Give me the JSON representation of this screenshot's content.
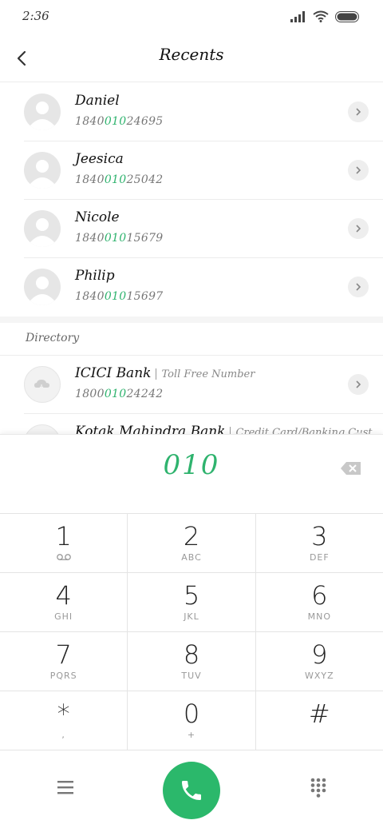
{
  "status": {
    "time": "2:36"
  },
  "header": {
    "title": "Recents"
  },
  "recents": [
    {
      "name": "Daniel",
      "number_pre": "1840",
      "number_match": "010",
      "number_post": "24695"
    },
    {
      "name": "Jeesica",
      "number_pre": "1840",
      "number_match": "010",
      "number_post": "25042"
    },
    {
      "name": "Nicole",
      "number_pre": "1840",
      "number_match": "010",
      "number_post": "15679"
    },
    {
      "name": "Philip",
      "number_pre": "1840",
      "number_match": "010",
      "number_post": "15697"
    }
  ],
  "directory": {
    "label": "Directory",
    "items": [
      {
        "name": "ICICI Bank",
        "subtitle": "Toll Free Number",
        "number_pre": "1800",
        "number_match": "010",
        "number_post": "24242"
      },
      {
        "name": "Kotak Mahindra Bank",
        "subtitle": "Credit Card/Banking Cust",
        "number_pre": "",
        "number_match": "",
        "number_post": ""
      }
    ]
  },
  "dialer": {
    "input": "010",
    "keys": [
      {
        "digit": "1",
        "letters": ""
      },
      {
        "digit": "2",
        "letters": "ABC"
      },
      {
        "digit": "3",
        "letters": "DEF"
      },
      {
        "digit": "4",
        "letters": "GHI"
      },
      {
        "digit": "5",
        "letters": "JKL"
      },
      {
        "digit": "6",
        "letters": "MNO"
      },
      {
        "digit": "7",
        "letters": "PQRS"
      },
      {
        "digit": "8",
        "letters": "TUV"
      },
      {
        "digit": "9",
        "letters": "WXYZ"
      },
      {
        "digit": "*",
        "letters": ","
      },
      {
        "digit": "0",
        "letters": "+"
      },
      {
        "digit": "#",
        "letters": ""
      }
    ]
  },
  "colors": {
    "accent": "#2fb36e",
    "call": "#2bb86b"
  },
  "icons": [
    "back-icon",
    "signal-icon",
    "wifi-icon",
    "battery-icon",
    "chevron-right-icon",
    "voicemail-icon",
    "backspace-icon",
    "menu-icon",
    "phone-icon",
    "dialpad-icon",
    "cloud-icon"
  ]
}
